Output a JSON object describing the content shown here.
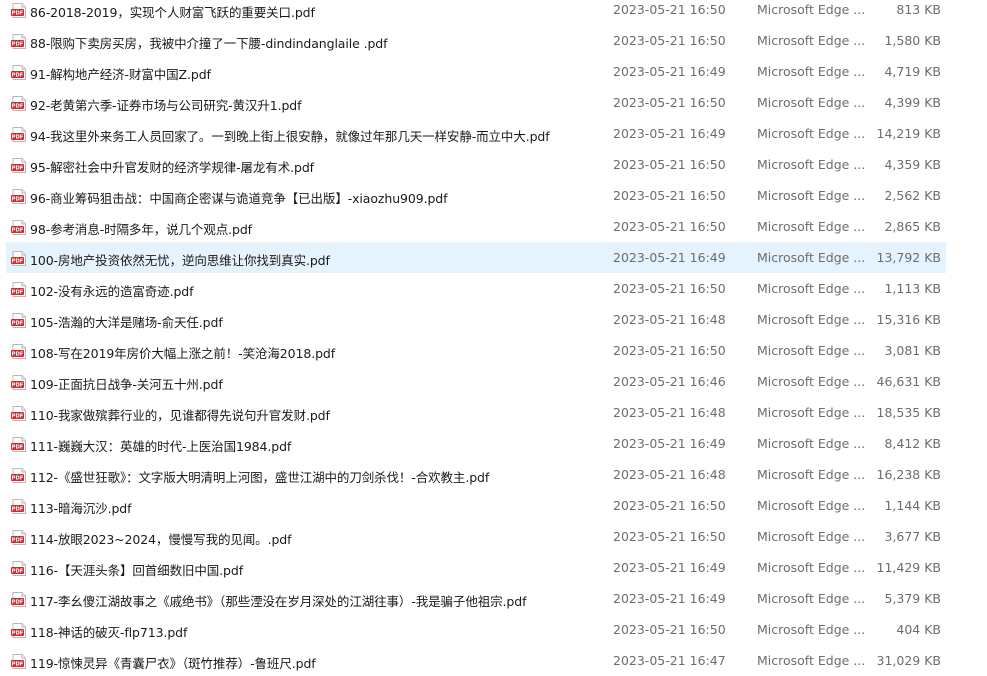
{
  "files": [
    {
      "name": "86-2018-2019，实现个人财富飞跃的重要关口.pdf",
      "modified": "2023-05-21 16:50",
      "type": "Microsoft Edge ...",
      "size": "813 KB",
      "selected": false
    },
    {
      "name": "88-限购下卖房买房，我被中介撞了一下腰-dindindanglaile .pdf",
      "modified": "2023-05-21 16:50",
      "type": "Microsoft Edge ...",
      "size": "1,580 KB",
      "selected": false
    },
    {
      "name": "91-解构地产经济-财富中国Z.pdf",
      "modified": "2023-05-21 16:49",
      "type": "Microsoft Edge ...",
      "size": "4,719 KB",
      "selected": false
    },
    {
      "name": "92-老黄第六季-证券市场与公司研究-黄汉升1.pdf",
      "modified": "2023-05-21 16:50",
      "type": "Microsoft Edge ...",
      "size": "4,399 KB",
      "selected": false
    },
    {
      "name": "94-我这里外来务工人员回家了。一到晚上街上很安静，就像过年那几天一样安静-而立中大.pdf",
      "modified": "2023-05-21 16:49",
      "type": "Microsoft Edge ...",
      "size": "14,219 KB",
      "selected": false
    },
    {
      "name": "95-解密社会中升官发财的经济学规律-屠龙有术.pdf",
      "modified": "2023-05-21 16:50",
      "type": "Microsoft Edge ...",
      "size": "4,359 KB",
      "selected": false
    },
    {
      "name": "96-商业筹码狙击战：中国商企密谋与诡道竞争【已出版】-xiaozhu909.pdf",
      "modified": "2023-05-21 16:50",
      "type": "Microsoft Edge ...",
      "size": "2,562 KB",
      "selected": false
    },
    {
      "name": "98-参考消息-时隔多年，说几个观点.pdf",
      "modified": "2023-05-21 16:50",
      "type": "Microsoft Edge ...",
      "size": "2,865 KB",
      "selected": false
    },
    {
      "name": "100-房地产投资依然无忧，逆向思维让你找到真实.pdf",
      "modified": "2023-05-21 16:49",
      "type": "Microsoft Edge ...",
      "size": "13,792 KB",
      "selected": true
    },
    {
      "name": "102-没有永远的造富奇迹.pdf",
      "modified": "2023-05-21 16:50",
      "type": "Microsoft Edge ...",
      "size": "1,113 KB",
      "selected": false
    },
    {
      "name": "105-浩瀚的大洋是赌场-俞天任.pdf",
      "modified": "2023-05-21 16:48",
      "type": "Microsoft Edge ...",
      "size": "15,316 KB",
      "selected": false
    },
    {
      "name": "108-写在2019年房价大幅上涨之前！-笑沧海2018.pdf",
      "modified": "2023-05-21 16:50",
      "type": "Microsoft Edge ...",
      "size": "3,081 KB",
      "selected": false
    },
    {
      "name": "109-正面抗日战争-关河五十州.pdf",
      "modified": "2023-05-21 16:46",
      "type": "Microsoft Edge ...",
      "size": "46,631 KB",
      "selected": false
    },
    {
      "name": "110-我家做殡葬行业的，见谁都得先说句升官发财.pdf",
      "modified": "2023-05-21 16:48",
      "type": "Microsoft Edge ...",
      "size": "18,535 KB",
      "selected": false
    },
    {
      "name": "111-巍巍大汉：英雄的时代-上医治国1984.pdf",
      "modified": "2023-05-21 16:49",
      "type": "Microsoft Edge ...",
      "size": "8,412 KB",
      "selected": false
    },
    {
      "name": "112-《盛世狂歌》：文字版大明清明上河图，盛世江湖中的刀剑杀伐！-合欢教主.pdf",
      "modified": "2023-05-21 16:48",
      "type": "Microsoft Edge ...",
      "size": "16,238 KB",
      "selected": false
    },
    {
      "name": "113-暗海沉沙.pdf",
      "modified": "2023-05-21 16:50",
      "type": "Microsoft Edge ...",
      "size": "1,144 KB",
      "selected": false
    },
    {
      "name": "114-放眼2023~2024，慢慢写我的见闻。.pdf",
      "modified": "2023-05-21 16:50",
      "type": "Microsoft Edge ...",
      "size": "3,677 KB",
      "selected": false
    },
    {
      "name": "116-【天涯头条】回首细数旧中国.pdf",
      "modified": "2023-05-21 16:49",
      "type": "Microsoft Edge ...",
      "size": "11,429 KB",
      "selected": false
    },
    {
      "name": "117-李幺傻江湖故事之《戚绝书》（那些湮没在岁月深处的江湖往事）-我是骗子他祖宗.pdf",
      "modified": "2023-05-21 16:49",
      "type": "Microsoft Edge ...",
      "size": "5,379 KB",
      "selected": false
    },
    {
      "name": "118-神话的破灭-flp713.pdf",
      "modified": "2023-05-21 16:50",
      "type": "Microsoft Edge ...",
      "size": "404 KB",
      "selected": false
    },
    {
      "name": "119-惊悚灵异《青囊尸衣》（斑竹推荐）-鲁班尺.pdf",
      "modified": "2023-05-21 16:47",
      "type": "Microsoft Edge ...",
      "size": "31,029 KB",
      "selected": false
    }
  ],
  "colors": {
    "selected_background": "#e5f3ff",
    "pdf_icon_red": "#d9272e",
    "secondary_text": "#6d6d6d"
  },
  "icon": "pdf-file-icon"
}
